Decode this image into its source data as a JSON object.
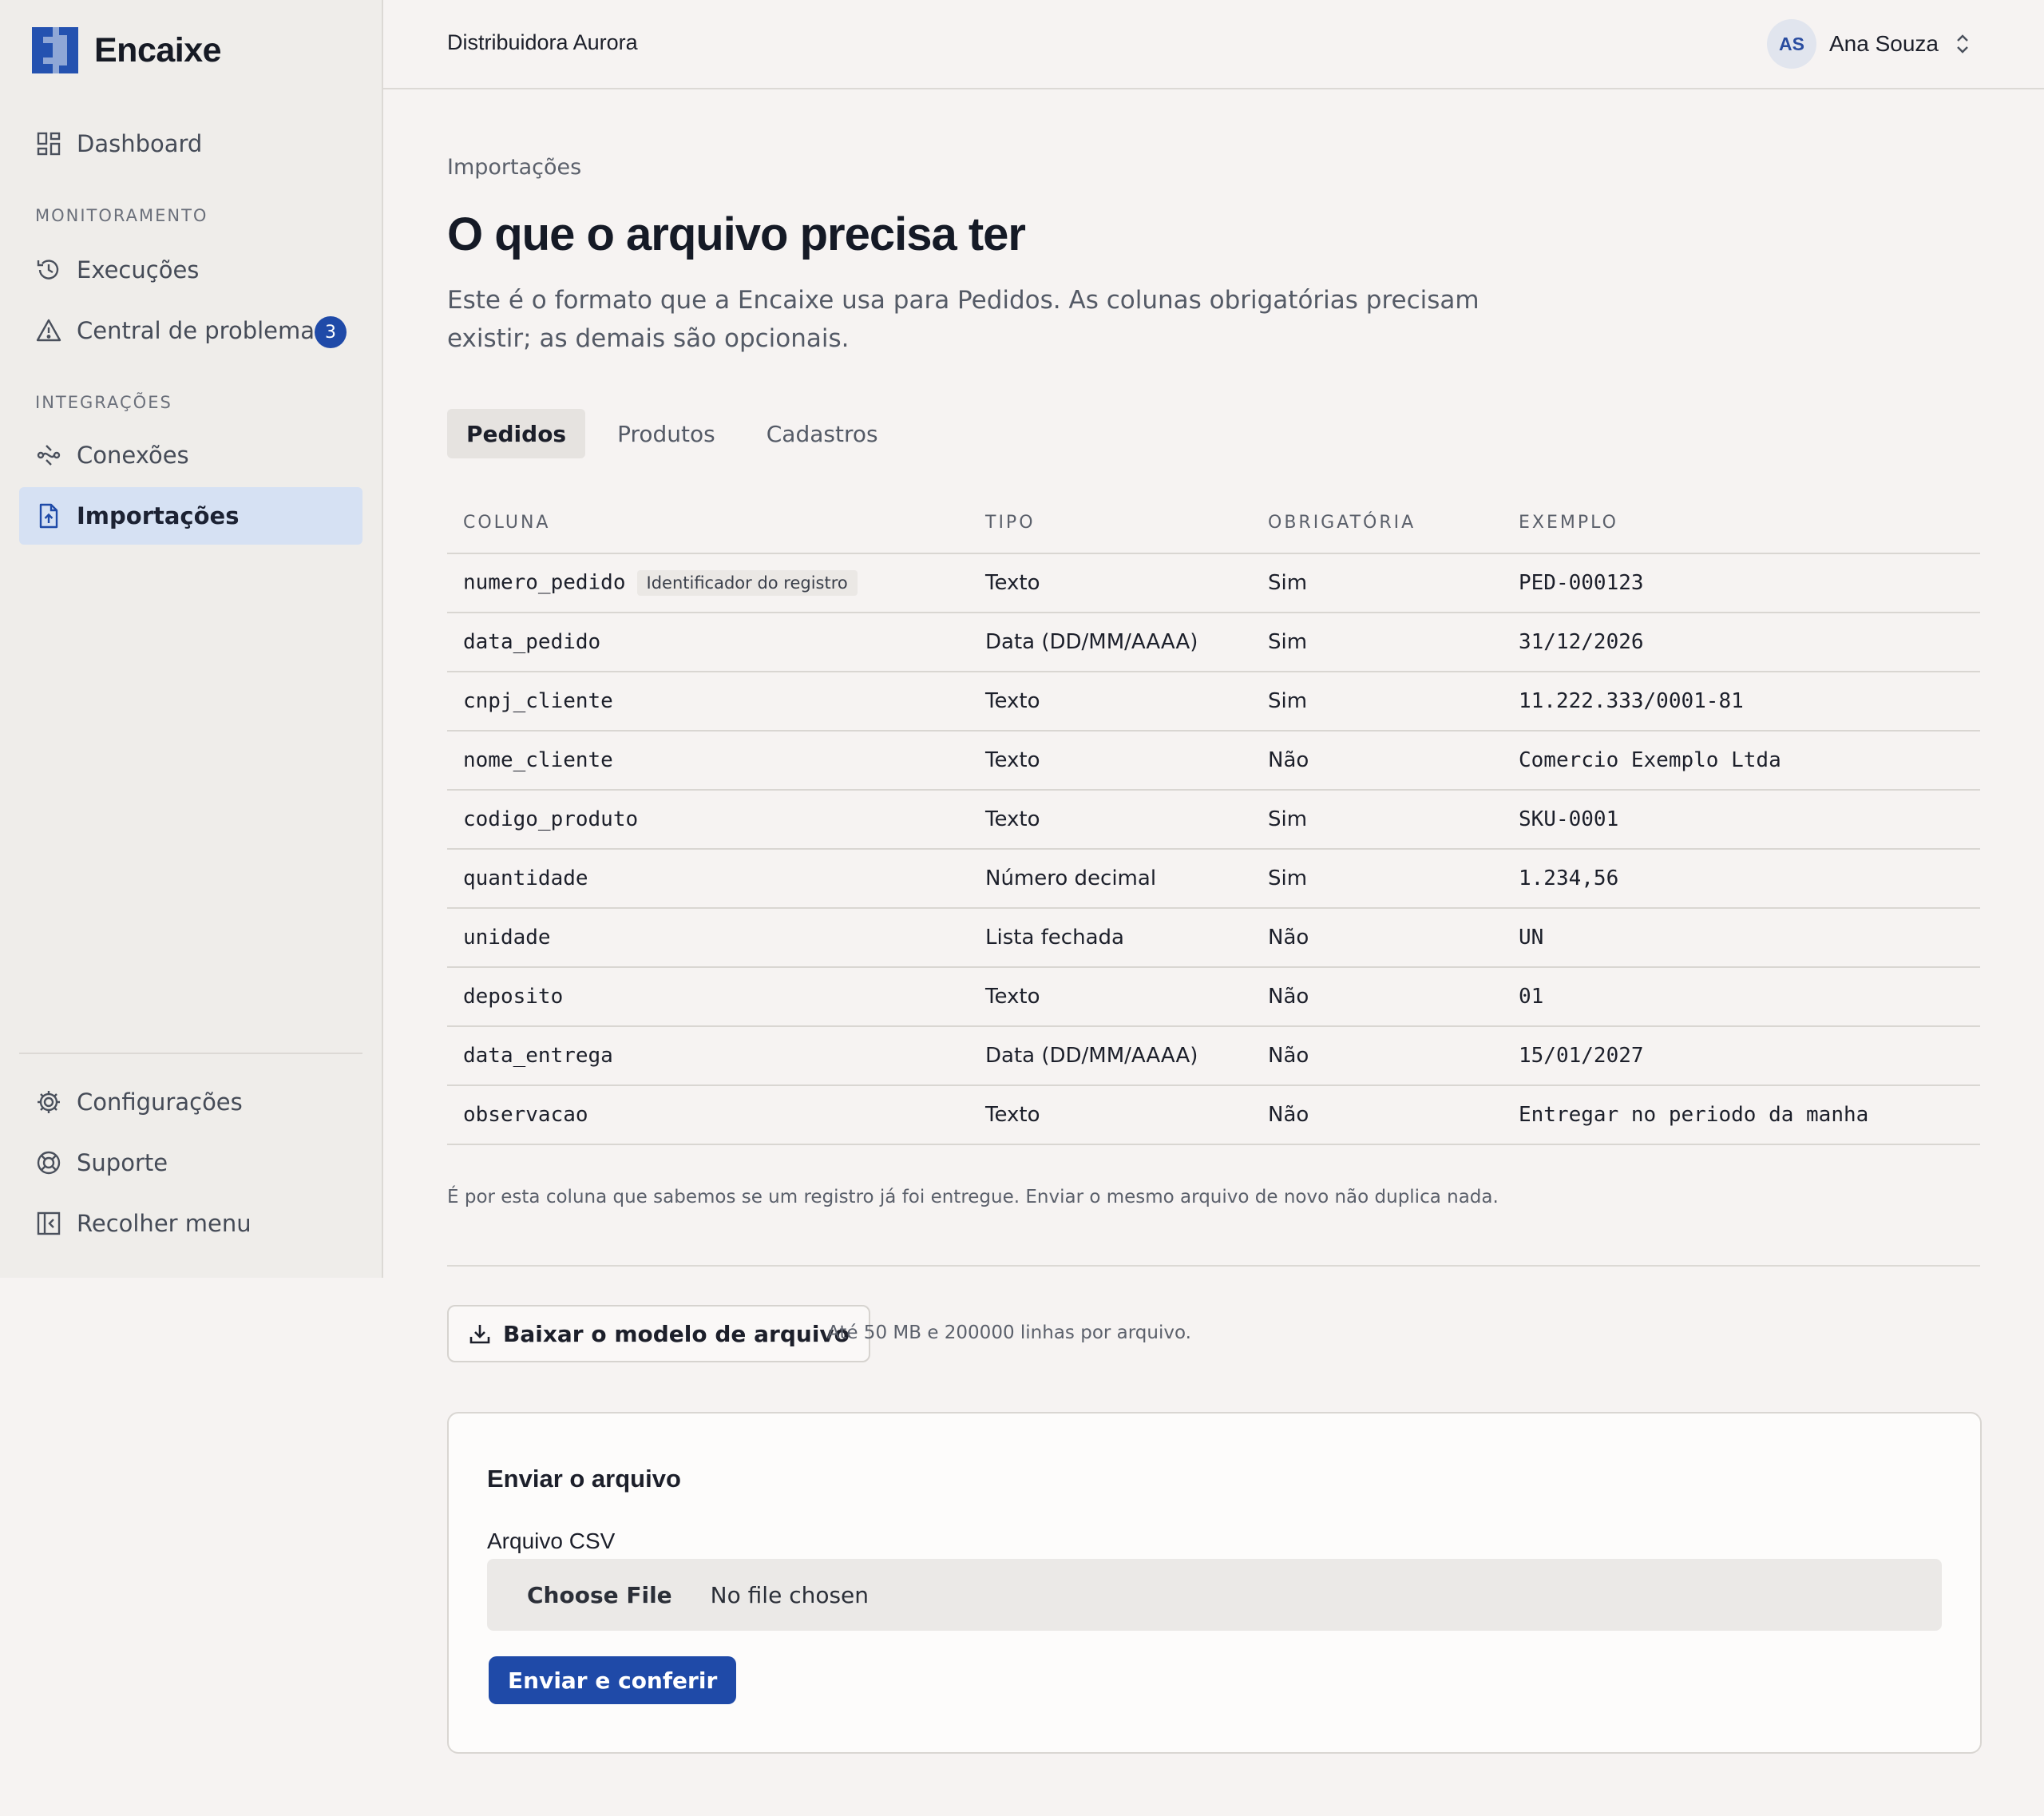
{
  "colors": {
    "accent": "#1f4aa8",
    "active_nav": "#d6e1f3",
    "sidebar_bg": "#efedea",
    "page_bg": "#f6f3f2"
  },
  "brand": {
    "name": "Encaixe"
  },
  "sidebar": {
    "dashboard": {
      "label": "Dashboard",
      "icon": "grid-icon"
    },
    "section_monitoring": "MONITORAMENTO",
    "executions": {
      "label": "Execuções",
      "icon": "history-icon"
    },
    "problems": {
      "label": "Central de problemas",
      "icon": "warning-icon",
      "badge": "3"
    },
    "section_integrations": "INTEGRAÇÕES",
    "connections": {
      "label": "Conexões",
      "icon": "connections-icon"
    },
    "imports": {
      "label": "Importações",
      "icon": "file-upload-icon"
    },
    "settings": {
      "label": "Configurações",
      "icon": "gear-icon"
    },
    "support": {
      "label": "Suporte",
      "icon": "lifebuoy-icon"
    },
    "collapse": {
      "label": "Recolher menu",
      "icon": "collapse-sidebar-icon"
    }
  },
  "topbar": {
    "organization": "Distribuidora Aurora",
    "user": {
      "initials": "AS",
      "name": "Ana Souza"
    }
  },
  "main": {
    "breadcrumb": "Importações",
    "title": "O que o arquivo precisa ter",
    "description": "Este é o formato que a Encaixe usa para Pedidos. As colunas obrigatórias precisam existir; as demais são opcionais.",
    "tabs": [
      {
        "label": "Pedidos",
        "active": true
      },
      {
        "label": "Produtos",
        "active": false
      },
      {
        "label": "Cadastros",
        "active": false
      }
    ],
    "table": {
      "headers": [
        "COLUNA",
        "TIPO",
        "OBRIGATÓRIA",
        "EXEMPLO"
      ],
      "identifier_chip": "Identificador do registro",
      "rows": [
        {
          "column": "numero_pedido",
          "type": "Texto",
          "required": "Sim",
          "example": "PED-000123"
        },
        {
          "column": "data_pedido",
          "type": "Data (DD/MM/AAAA)",
          "required": "Sim",
          "example": "31/12/2026"
        },
        {
          "column": "cnpj_cliente",
          "type": "Texto",
          "required": "Sim",
          "example": "11.222.333/0001-81"
        },
        {
          "column": "nome_cliente",
          "type": "Texto",
          "required": "Não",
          "example": "Comercio Exemplo Ltda"
        },
        {
          "column": "codigo_produto",
          "type": "Texto",
          "required": "Sim",
          "example": "SKU-0001"
        },
        {
          "column": "quantidade",
          "type": "Número decimal",
          "required": "Sim",
          "example": "1.234,56"
        },
        {
          "column": "unidade",
          "type": "Lista fechada",
          "required": "Não",
          "example": "UN"
        },
        {
          "column": "deposito",
          "type": "Texto",
          "required": "Não",
          "example": "01"
        },
        {
          "column": "data_entrega",
          "type": "Data (DD/MM/AAAA)",
          "required": "Não",
          "example": "15/01/2027"
        },
        {
          "column": "observacao",
          "type": "Texto",
          "required": "Não",
          "example": "Entregar no periodo da manha"
        }
      ]
    },
    "identifier_note": "É por esta coluna que sabemos se um registro já foi entregue. Enviar o mesmo arquivo de novo não duplica nada.",
    "download_button": "Baixar o modelo de arquivo",
    "limits": "Até 50 MB e 200000 linhas por arquivo."
  },
  "upload": {
    "title": "Enviar o arquivo",
    "field_label": "Arquivo CSV",
    "choose_file": "Choose File",
    "file_status": "No file chosen",
    "submit": "Enviar e conferir"
  }
}
